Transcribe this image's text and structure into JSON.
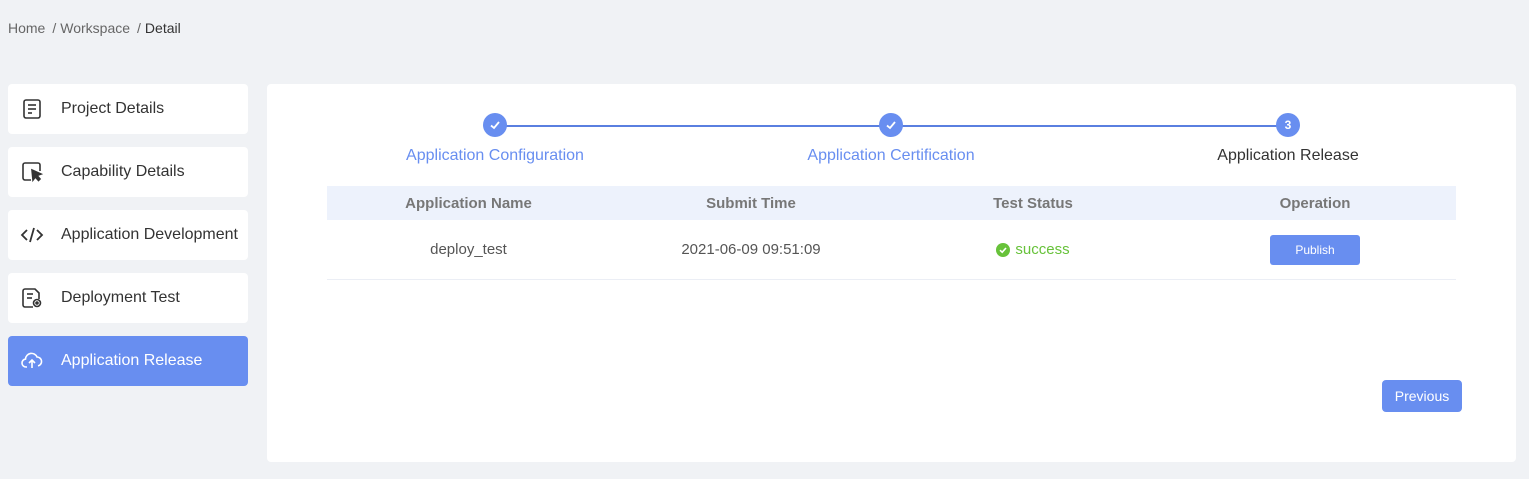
{
  "breadcrumb": [
    "Home",
    "Workspace",
    "Detail"
  ],
  "breadcrumb_separator": "/",
  "sidebar": {
    "items": [
      {
        "label": "Project Details",
        "icon": "document-icon"
      },
      {
        "label": "Capability Details",
        "icon": "pointer-icon"
      },
      {
        "label": "Application Development",
        "icon": "code-icon"
      },
      {
        "label": "Deployment Test",
        "icon": "test-doc-icon"
      },
      {
        "label": "Application Release",
        "icon": "cloud-upload-icon",
        "active": true
      }
    ]
  },
  "steps": [
    {
      "label": "Application Configuration",
      "status": "done"
    },
    {
      "label": "Application Certification",
      "status": "done"
    },
    {
      "label": "Application Release",
      "status": "current",
      "number": "3"
    }
  ],
  "table": {
    "headers": [
      "Application Name",
      "Submit Time",
      "Test Status",
      "Operation"
    ],
    "rows": [
      {
        "name": "deploy_test",
        "submit_time": "2021-06-09 09:51:09",
        "status": "success",
        "action": "Publish"
      }
    ]
  },
  "buttons": {
    "previous": "Previous"
  },
  "colors": {
    "accent": "#688ef0",
    "success": "#67c23a",
    "background": "#f0f2f5"
  }
}
